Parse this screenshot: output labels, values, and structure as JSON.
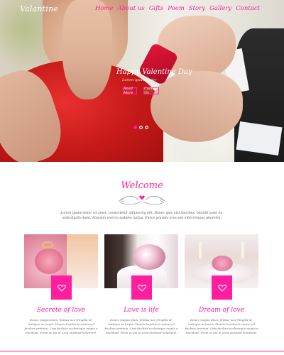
{
  "header": {
    "logo": "Valantine",
    "nav": [
      "Home",
      "About us",
      "Gifts",
      "Poem",
      "Story",
      "Gallery",
      "Contact"
    ]
  },
  "hero": {
    "title": "Happy Valentine Day",
    "subtitle": "Lorem ipsum dolor",
    "buttons": {
      "more": "Read More",
      "contact": "Contact Us"
    },
    "slides": 3,
    "active_slide": 1
  },
  "welcome": {
    "title": "Welcome",
    "intro": "Lorem ipsum dolor sit amet, consectetur adipiscing elit. Donec quis nisl faucibus, blandit justo eu, sollicitudin diam. Aliquam viverra sodales luctus. Fusce gravida eros sed nibh tempus pharetra."
  },
  "cards": [
    {
      "title": "Secrete of love",
      "text": "Donec magna diam, finibus non fringilla id, tristique in turpis. Mauris hendrerit metus vel facilisis pretium. Cras facilisis scelerisque neque a tincidunt. Proin et dui in urna euismod hendrerit."
    },
    {
      "title": "Love is life",
      "text": "Donec magna diam, finibus non fringilla id, tristique in turpis. Mauris hendrerit metus vel facilisis pretium. Cras facilisis scelerisque neque a tincidunt. Proin et dui in urna euismod hendrerit."
    },
    {
      "title": "Dream of love",
      "text": "Donec magna diam, finibus non fringilla id, tristique in turpis. Mauris hendrerit metus vel facilisis pretium. Cras facilisis scelerisque neque a tincidunt. Proin et dui in urna euismod hendrerit."
    }
  ],
  "colors": {
    "accent": "#ff1f9e"
  }
}
